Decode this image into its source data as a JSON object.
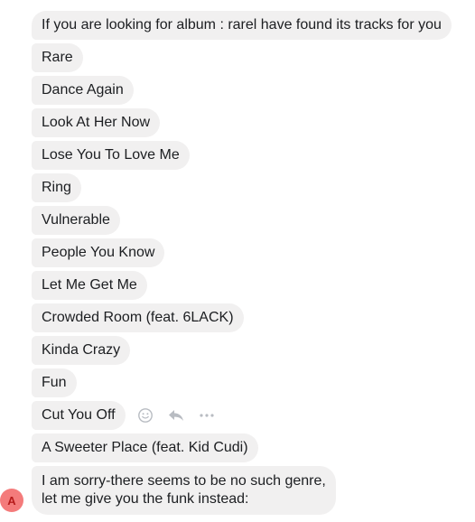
{
  "messages": [
    "If you are looking for album :  rarel have found its tracks for you",
    "Rare",
    "Dance Again",
    "Look At Her Now",
    "Lose You To Love Me",
    "Ring",
    "Vulnerable",
    "People You Know",
    "Let Me Get Me",
    "Crowded Room (feat. 6LACK)",
    "Kinda Crazy",
    "Fun",
    "Cut You Off",
    "A Sweeter Place (feat. Kid Cudi)",
    "I am sorry-there seems to be no such genre,\n let me give you the funk instead:"
  ],
  "avatar": {
    "letter": "A",
    "color": "#f47b7b"
  },
  "hover_actions": {
    "icons": [
      "smiley-icon",
      "reply-icon",
      "more-icon"
    ]
  }
}
